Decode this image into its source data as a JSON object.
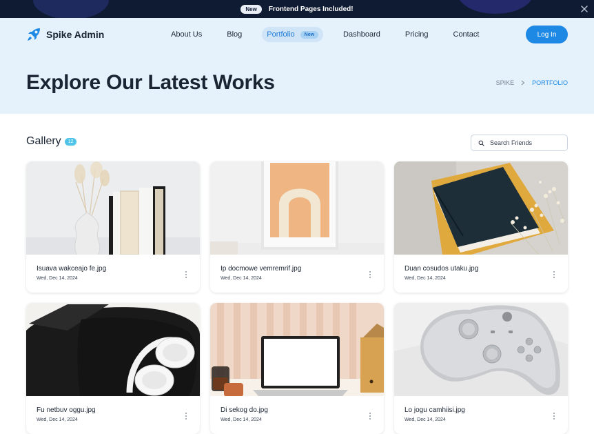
{
  "announcement": {
    "badge": "New",
    "message": "Frontend Pages Included!"
  },
  "brand": {
    "name": "Spike Admin",
    "accent": "#1d89e4"
  },
  "nav": {
    "items": [
      {
        "label": "About Us"
      },
      {
        "label": "Blog"
      },
      {
        "label": "Portfolio",
        "badge": "New",
        "active": true
      },
      {
        "label": "Dashboard"
      },
      {
        "label": "Pricing"
      },
      {
        "label": "Contact"
      }
    ],
    "login_label": "Log In"
  },
  "hero": {
    "title": "Explore Our Latest Works",
    "breadcrumb": [
      "SPIKE",
      "PORTFOLIO"
    ]
  },
  "gallery": {
    "title": "Gallery",
    "count": "12",
    "search_placeholder": "Search Friends",
    "items": [
      {
        "name": "Isuava wakceajo fe.jpg",
        "date": "Wed, Dec 14, 2024",
        "image": "vase-and-books"
      },
      {
        "name": "Ip docmowe vemremrif.jpg",
        "date": "Wed, Dec 14, 2024",
        "image": "framed-arch-print"
      },
      {
        "name": "Duan cosudos utaku.jpg",
        "date": "Wed, Dec 14, 2024",
        "image": "book-with-flowers"
      },
      {
        "name": "Fu netbuv oggu.jpg",
        "date": "Wed, Dec 14, 2024",
        "image": "headphones-in-case"
      },
      {
        "name": "Di sekog do.jpg",
        "date": "Wed, Dec 14, 2024",
        "image": "laptop-on-desk"
      },
      {
        "name": "Lo jogu camhiisi.jpg",
        "date": "Wed, Dec 14, 2024",
        "image": "game-controller"
      }
    ]
  }
}
